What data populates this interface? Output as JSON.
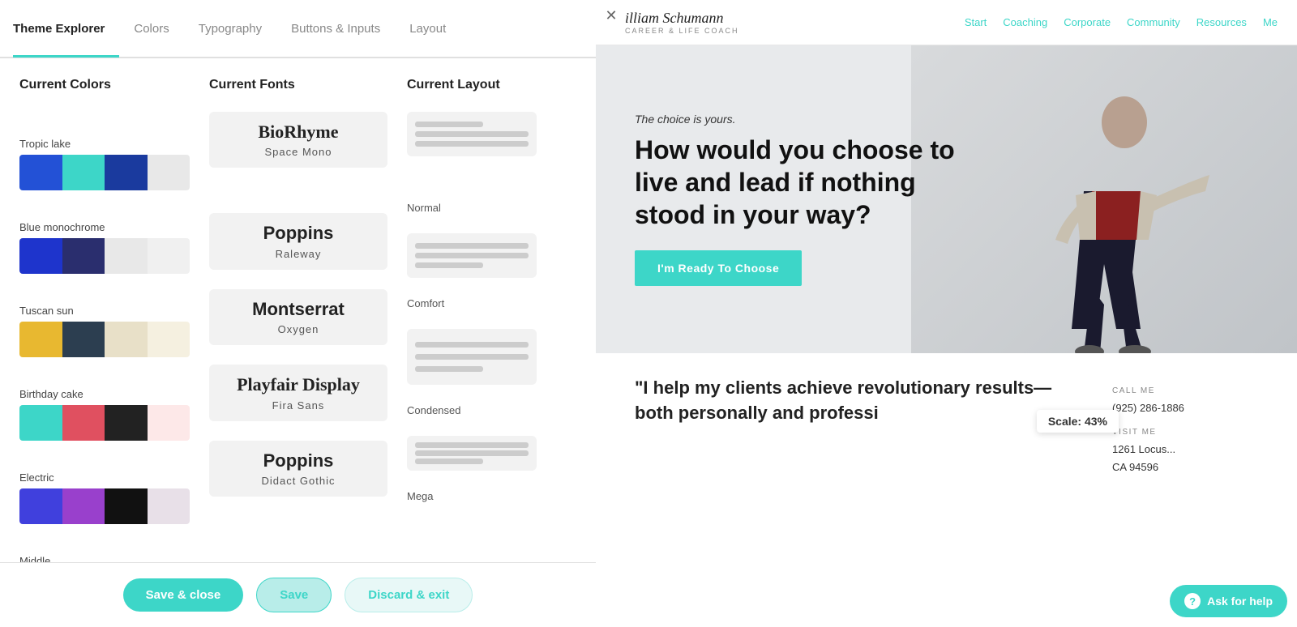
{
  "tabs": [
    {
      "label": "Theme Explorer",
      "active": true
    },
    {
      "label": "Colors",
      "active": false
    },
    {
      "label": "Typography",
      "active": false
    },
    {
      "label": "Buttons & Inputs",
      "active": false
    },
    {
      "label": "Layout",
      "active": false
    }
  ],
  "sections": {
    "current_colors": {
      "title": "Current Colors",
      "swatches": [
        "#3dd6c8",
        "#f47c5e",
        "#222222",
        "#d8d8d8"
      ]
    },
    "current_fonts": {
      "title": "Current Fonts",
      "primary": "BioRhyme",
      "secondary": "Space  Mono"
    },
    "current_layout": {
      "title": "Current Layout"
    }
  },
  "color_groups": [
    {
      "label": "Tropic lake",
      "swatches": [
        "#2351d6",
        "#3dd6c8",
        "#1a3a9e",
        "#e8e8e8"
      ]
    },
    {
      "label": "Blue monochrome",
      "swatches": [
        "#1e34cc",
        "#2a2e6e",
        "#e8e8e8",
        "#f0f0f0"
      ]
    },
    {
      "label": "Tuscan sun",
      "swatches": [
        "#e8b830",
        "#2c3e50",
        "#e8e0c8",
        "#f5f0e0"
      ]
    },
    {
      "label": "Birthday cake",
      "swatches": [
        "#3dd6c8",
        "#e05060",
        "#222222",
        "#fde8e8"
      ]
    },
    {
      "label": "Electric",
      "swatches": [
        "#4040dd",
        "#9940cc",
        "#111111",
        "#e8e0e8"
      ]
    },
    {
      "label": "Middle ...",
      "swatches": [
        "#cc8844",
        "#3366cc",
        "#222222",
        "#e8e8e8"
      ]
    }
  ],
  "font_options": [
    {
      "primary": "Poppins",
      "secondary": "Raleway",
      "primary_weight": "bold"
    },
    {
      "primary": "Montserrat",
      "secondary": "Oxygen",
      "primary_weight": "bold"
    },
    {
      "primary": "Playfair Display",
      "secondary": "Fira Sans",
      "primary_weight": "bold"
    },
    {
      "primary": "Poppins",
      "secondary": "Didact Gothic",
      "primary_weight": "bold"
    }
  ],
  "layout_options": [
    {
      "label": "Normal"
    },
    {
      "label": "Comfort"
    },
    {
      "label": "Condensed"
    },
    {
      "label": "Mega"
    }
  ],
  "buttons": {
    "save_close": "Save & close",
    "save": "Save",
    "discard": "Discard & exit"
  },
  "website": {
    "close_icon": "✕",
    "logo_name": "illiam Schumann",
    "logo_tagline": "CAREER & LIFE COACH",
    "nav": [
      "Start",
      "Coaching",
      "Corporate",
      "Community",
      "Resources",
      "Me"
    ],
    "hero": {
      "subtitle": "The choice is yours.",
      "title": "How would you choose to live and lead if nothing stood in your way?",
      "cta": "I'm Ready To Choose"
    },
    "quote": "\"I help my clients achieve revolutionary results—both personally and professi",
    "contact": {
      "call_label": "CALL ME",
      "call_value": "(925) 286-1886",
      "visit_label": "VISIT ME",
      "visit_value": "1261 Locus...\nCA 94596"
    },
    "scale_badge": "Scale: 43%",
    "ask_help": "Ask for help"
  }
}
